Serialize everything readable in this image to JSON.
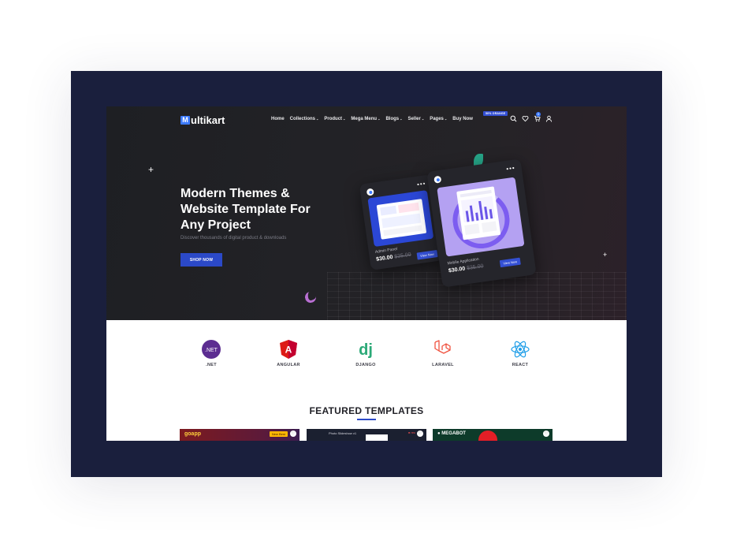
{
  "brand": {
    "logo_mark": "M",
    "logo_text": "ultikart"
  },
  "nav": {
    "items": [
      {
        "label": "Home",
        "has_dropdown": false
      },
      {
        "label": "Collections",
        "has_dropdown": true
      },
      {
        "label": "Product",
        "has_dropdown": true
      },
      {
        "label": "Mega Menu",
        "has_dropdown": true
      },
      {
        "label": "Blogs",
        "has_dropdown": true
      },
      {
        "label": "Seller",
        "has_dropdown": true
      },
      {
        "label": "Pages",
        "has_dropdown": true
      },
      {
        "label": "Buy Now",
        "has_dropdown": false
      }
    ],
    "buy_badge": "50% ORANGE",
    "icons": [
      "search-icon",
      "heart-icon",
      "cart-icon",
      "user-icon"
    ],
    "cart_count": "0"
  },
  "hero": {
    "title": "Modern Themes & Website Template For Any Project",
    "subtitle": "Discover thousands of digital product & downloads",
    "cta": "SHOP NOW",
    "cards": [
      {
        "name": "Admin Panel",
        "price": "$30.00",
        "old_price": "$35.00",
        "button": "View Now"
      },
      {
        "name": "Mobile Application",
        "price": "$30.00",
        "old_price": "$35.00",
        "button": "View Now"
      }
    ]
  },
  "tech": [
    {
      "label": ".NET",
      "icon": "dotnet-icon",
      "glyph": ".NET",
      "color": "#5c2d91"
    },
    {
      "label": "ANGULAR",
      "icon": "angular-icon",
      "glyph": "A",
      "color": "#dd1b16"
    },
    {
      "label": "DJANGO",
      "icon": "django-icon",
      "glyph": "dj",
      "color": "#2ba977"
    },
    {
      "label": "LARAVEL",
      "icon": "laravel-icon",
      "glyph": "",
      "color": "#f05340"
    },
    {
      "label": "REACT",
      "icon": "react-icon",
      "glyph": "",
      "color": "#1f9ee8"
    }
  ],
  "featured": {
    "title": "FEATURED TEMPLATES",
    "thumbs": [
      {
        "logo": "goapp",
        "tag": "New Best",
        "bg": "#7d1a1f"
      },
      {
        "logo": "",
        "text": "Photo Slideshow v1",
        "rec": "● rec",
        "bg": "#1b2030"
      },
      {
        "logo": "● MEGABOT",
        "bg": "#0d3b2a"
      }
    ]
  },
  "colors": {
    "frame": "#1a1f3d",
    "hero_bg": "#222226",
    "accent": "#2b49c8"
  }
}
